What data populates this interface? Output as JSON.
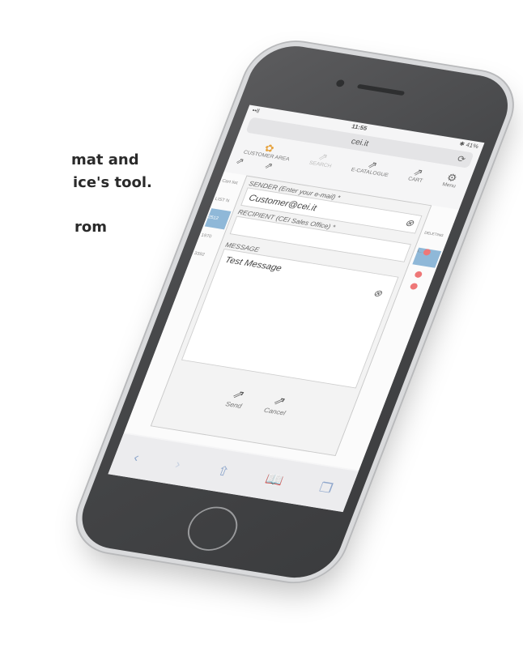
{
  "background_text": {
    "line1": "mat and",
    "line2": "ice's tool.",
    "line3": "rom"
  },
  "status_bar": {
    "carrier": "••ll",
    "time": "11:55",
    "battery": "✱ 41%"
  },
  "browser": {
    "url": "cei.it",
    "reload_icon": "⟳"
  },
  "toolbar": {
    "items": [
      {
        "label": "CUSTOMER AREA",
        "icon": "customer-area-icon"
      },
      {
        "label": "SEARCH",
        "icon": "share-icon"
      },
      {
        "label": "E-CATALOGUE",
        "icon": "share-icon"
      },
      {
        "label": "CART",
        "icon": "share-icon"
      },
      {
        "label": "Menu",
        "icon": "gear-icon"
      }
    ]
  },
  "side": {
    "cart_list": "Cart list",
    "col_label": "LIST N",
    "rows": [
      "2512",
      "1970",
      "3392"
    ]
  },
  "right_column": {
    "header": "DELETING L..."
  },
  "dialog": {
    "sender_label": "SENDER (Enter your e-mail) *",
    "sender_value": "Customer@cei.it",
    "recipient_label": "RECIPIENT (CEI Sales Office) *",
    "recipient_value": "",
    "message_label": "MESSAGE",
    "message_value": "Test Message",
    "send_label": "Send",
    "cancel_label": "Cancel"
  },
  "colors": {
    "selected_row": "#8fb8d8",
    "delete_dot": "#e77777",
    "phone_body": "#4a4b4d"
  }
}
